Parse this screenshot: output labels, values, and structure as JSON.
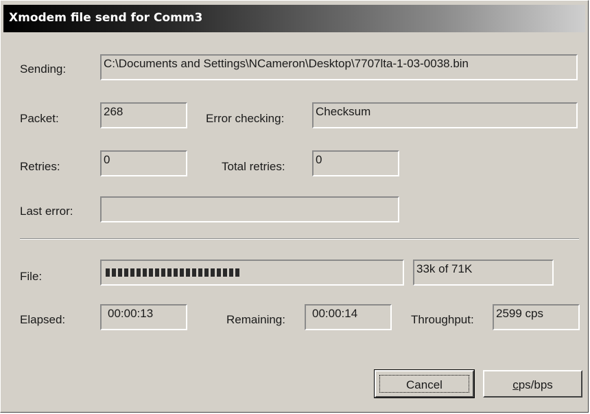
{
  "window": {
    "title": "Xmodem file send for Comm3"
  },
  "sending": {
    "label": "Sending:",
    "value": "C:\\Documents and Settings\\NCameron\\Desktop\\7707lta-1-03-0038.bin"
  },
  "packet": {
    "label": "Packet:",
    "value": "268"
  },
  "error_checking": {
    "label": "Error checking:",
    "value": "Checksum"
  },
  "retries": {
    "label": "Retries:",
    "value": "0"
  },
  "total_retries": {
    "label": "Total retries:",
    "value": "0"
  },
  "last_error": {
    "label": "Last error:",
    "value": ""
  },
  "file": {
    "label": "File:",
    "progress_fraction": 0.46,
    "size_text": "33k of 71K"
  },
  "elapsed": {
    "label": "Elapsed:",
    "value": "00:00:13"
  },
  "remaining": {
    "label": "Remaining:",
    "value": "00:00:14"
  },
  "throughput": {
    "label": "Throughput:",
    "value": "2599 cps"
  },
  "buttons": {
    "cancel": "Cancel",
    "cps_bps": "cps/bps"
  }
}
